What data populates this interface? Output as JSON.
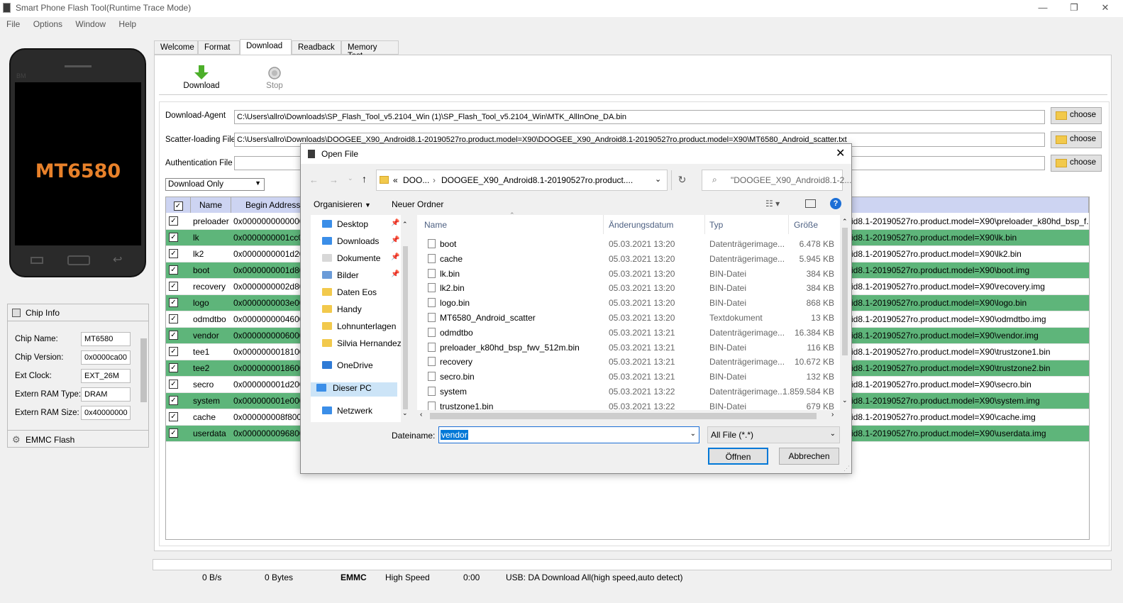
{
  "window": {
    "title": "Smart Phone Flash Tool(Runtime Trace Mode)"
  },
  "menu": [
    "File",
    "Options",
    "Window",
    "Help"
  ],
  "phone": {
    "chip_label": "MT6580",
    "brand": "BM"
  },
  "chip_info": {
    "header": "Chip Info",
    "fields": [
      {
        "label": "Chip Name:",
        "value": "MT6580"
      },
      {
        "label": "Chip Version:",
        "value": "0x0000ca00"
      },
      {
        "label": "Ext Clock:",
        "value": "EXT_26M"
      },
      {
        "label": "Extern RAM Type:",
        "value": "DRAM"
      },
      {
        "label": "Extern RAM Size:",
        "value": "0x40000000"
      }
    ]
  },
  "emmc": {
    "label": "EMMC Flash"
  },
  "tabs": [
    "Welcome",
    "Format",
    "Download",
    "Readback",
    "Memory Test"
  ],
  "toolbar": {
    "download": "Download",
    "stop": "Stop"
  },
  "fields": {
    "da_label": "Download-Agent",
    "da_value": "C:\\Users\\allro\\Downloads\\SP_Flash_Tool_v5.2104_Win (1)\\SP_Flash_Tool_v5.2104_Win\\MTK_AllInOne_DA.bin",
    "scatter_label": "Scatter-loading File",
    "scatter_value": "C:\\Users\\allro\\Downloads\\DOOGEE_X90_Android8.1-20190527ro.product.model=X90\\DOOGEE_X90_Android8.1-20190527ro.product.model=X90\\MT6580_Android_scatter.txt",
    "auth_label": "Authentication File",
    "auth_value": "",
    "choose": "choose",
    "mode": "Download Only"
  },
  "grid": {
    "headers": [
      "Name",
      "Begin Address"
    ],
    "rows": [
      {
        "name": "preloader",
        "addr": "0x0000000000000000",
        "loc": "id8.1-20190527ro.product.model=X90\\preloader_k80hd_bsp_f...",
        "green": false
      },
      {
        "name": "lk",
        "addr": "0x0000000001cc0000",
        "loc": "id8.1-20190527ro.product.model=X90\\lk.bin",
        "green": true
      },
      {
        "name": "lk2",
        "addr": "0x0000000001d20000",
        "loc": "id8.1-20190527ro.product.model=X90\\lk2.bin",
        "green": false
      },
      {
        "name": "boot",
        "addr": "0x0000000001d80000",
        "loc": "id8.1-20190527ro.product.model=X90\\boot.img",
        "green": true
      },
      {
        "name": "recovery",
        "addr": "0x0000000002d80000",
        "loc": "id8.1-20190527ro.product.model=X90\\recovery.img",
        "green": false
      },
      {
        "name": "logo",
        "addr": "0x0000000003e00000",
        "loc": "id8.1-20190527ro.product.model=X90\\logo.bin",
        "green": true
      },
      {
        "name": "odmdtbo",
        "addr": "0x0000000004600000",
        "loc": "id8.1-20190527ro.product.model=X90\\odmdtbo.img",
        "green": false
      },
      {
        "name": "vendor",
        "addr": "0x0000000006000000",
        "loc": "id8.1-20190527ro.product.model=X90\\vendor.img",
        "green": true
      },
      {
        "name": "tee1",
        "addr": "0x0000000018100000",
        "loc": "id8.1-20190527ro.product.model=X90\\trustzone1.bin",
        "green": false
      },
      {
        "name": "tee2",
        "addr": "0x0000000018600000",
        "loc": "id8.1-20190527ro.product.model=X90\\trustzone2.bin",
        "green": true
      },
      {
        "name": "secro",
        "addr": "0x000000001d200000",
        "loc": "id8.1-20190527ro.product.model=X90\\secro.bin",
        "green": false
      },
      {
        "name": "system",
        "addr": "0x000000001e000000",
        "loc": "id8.1-20190527ro.product.model=X90\\system.img",
        "green": true
      },
      {
        "name": "cache",
        "addr": "0x000000008f800000",
        "loc": "id8.1-20190527ro.product.model=X90\\cache.img",
        "green": false
      },
      {
        "name": "userdata",
        "addr": "0x0000000096800000",
        "loc": "id8.1-20190527ro.product.model=X90\\userdata.img",
        "green": true
      }
    ]
  },
  "status": {
    "speed": "0 B/s",
    "bytes": "0 Bytes",
    "storage": "EMMC",
    "mode": "High Speed",
    "time": "0:00",
    "usb": "USB: DA Download All(high speed,auto detect)"
  },
  "dialog": {
    "title": "Open File",
    "breadcrumb": [
      "DOO...",
      "DOOGEE_X90_Android8.1-20190527ro.product...."
    ],
    "breadcrumb_prefix": "«",
    "search_placeholder": "\"DOOGEE_X90_Android8.1-2...",
    "organize": "Organisieren",
    "new_folder": "Neuer Ordner",
    "nav": [
      {
        "label": "Desktop",
        "pin": true,
        "color": "#3b8ee8"
      },
      {
        "label": "Downloads",
        "pin": true,
        "color": "#3b8ee8"
      },
      {
        "label": "Dokumente",
        "pin": true,
        "color": "#d8d8d8"
      },
      {
        "label": "Bilder",
        "pin": true,
        "color": "#6a9bd8"
      },
      {
        "label": "Daten Eos",
        "pin": false,
        "color": "#f2c94c"
      },
      {
        "label": "Handy",
        "pin": false,
        "color": "#f2c94c"
      },
      {
        "label": "Lohnunterlagen",
        "pin": false,
        "color": "#f2c94c"
      },
      {
        "label": "Silvia Hernandez",
        "pin": false,
        "color": "#f2c94c"
      },
      {
        "label": "OneDrive",
        "pin": false,
        "color": "#2f7bd6"
      },
      {
        "label": "Dieser PC",
        "pin": false,
        "color": "#3b8ee8"
      },
      {
        "label": "Netzwerk",
        "pin": false,
        "color": "#3b8ee8"
      }
    ],
    "columns": [
      "Name",
      "Änderungsdatum",
      "Typ",
      "Größe"
    ],
    "files": [
      {
        "name": "boot",
        "date": "05.03.2021 13:20",
        "type": "Datenträgerimage...",
        "size": "6.478 KB"
      },
      {
        "name": "cache",
        "date": "05.03.2021 13:20",
        "type": "Datenträgerimage...",
        "size": "5.945 KB"
      },
      {
        "name": "lk.bin",
        "date": "05.03.2021 13:20",
        "type": "BIN-Datei",
        "size": "384 KB"
      },
      {
        "name": "lk2.bin",
        "date": "05.03.2021 13:20",
        "type": "BIN-Datei",
        "size": "384 KB"
      },
      {
        "name": "logo.bin",
        "date": "05.03.2021 13:20",
        "type": "BIN-Datei",
        "size": "868 KB"
      },
      {
        "name": "MT6580_Android_scatter",
        "date": "05.03.2021 13:20",
        "type": "Textdokument",
        "size": "13 KB"
      },
      {
        "name": "odmdtbo",
        "date": "05.03.2021 13:21",
        "type": "Datenträgerimage...",
        "size": "16.384 KB"
      },
      {
        "name": "preloader_k80hd_bsp_fwv_512m.bin",
        "date": "05.03.2021 13:21",
        "type": "BIN-Datei",
        "size": "116 KB"
      },
      {
        "name": "recovery",
        "date": "05.03.2021 13:21",
        "type": "Datenträgerimage...",
        "size": "10.672 KB"
      },
      {
        "name": "secro.bin",
        "date": "05.03.2021 13:21",
        "type": "BIN-Datei",
        "size": "132 KB"
      },
      {
        "name": "system",
        "date": "05.03.2021 13:22",
        "type": "Datenträgerimage...",
        "size": "1.859.584 KB"
      },
      {
        "name": "trustzone1.bin",
        "date": "05.03.2021 13:22",
        "type": "BIN-Datei",
        "size": "679 KB"
      }
    ],
    "filename_label": "Dateiname:",
    "filename_value": "vendor",
    "filetype": "All File (*.*)",
    "open": "Öffnen",
    "cancel": "Abbrechen"
  }
}
